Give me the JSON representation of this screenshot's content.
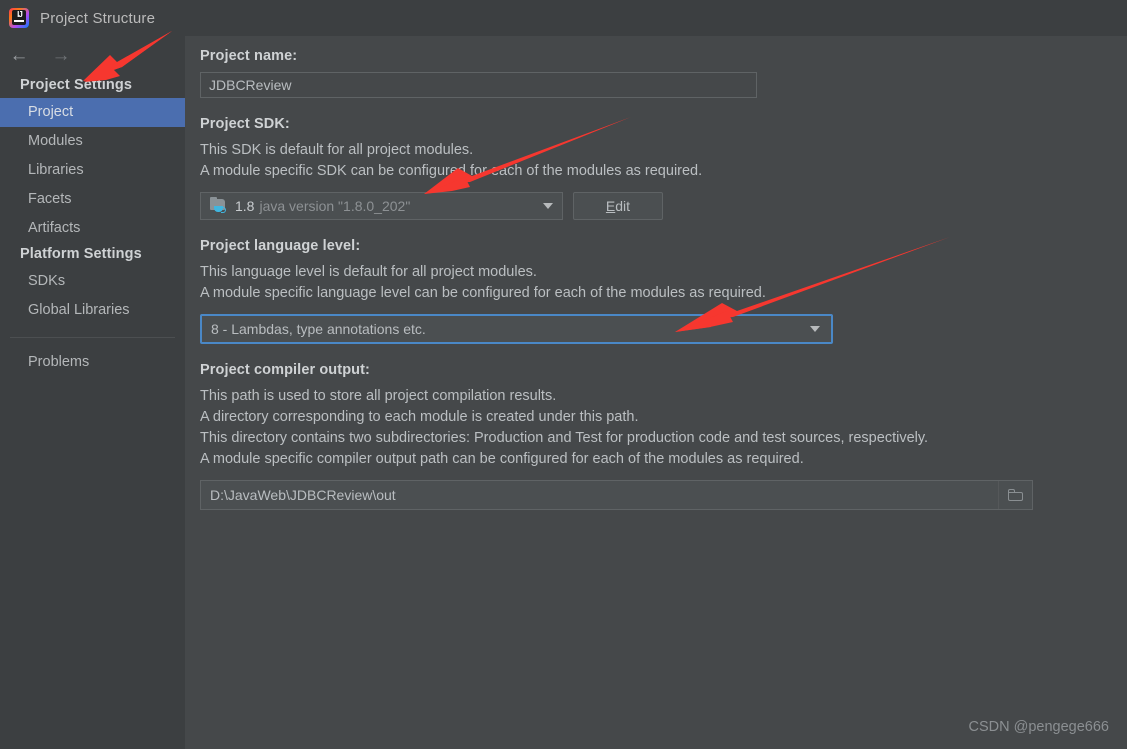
{
  "window": {
    "title": "Project Structure",
    "logo_icon": "intellij-idea-logo"
  },
  "sidebar": {
    "back_icon": "arrow-left-icon",
    "forward_icon": "arrow-right-icon",
    "groups": [
      {
        "header": "Project Settings",
        "items": [
          {
            "label": "Project",
            "selected": true
          },
          {
            "label": "Modules",
            "selected": false
          },
          {
            "label": "Libraries",
            "selected": false
          },
          {
            "label": "Facets",
            "selected": false
          },
          {
            "label": "Artifacts",
            "selected": false
          }
        ]
      },
      {
        "header": "Platform Settings",
        "items": [
          {
            "label": "SDKs",
            "selected": false
          },
          {
            "label": "Global Libraries",
            "selected": false
          }
        ]
      }
    ],
    "problems": {
      "label": "Problems"
    }
  },
  "main": {
    "project_name": {
      "label": "Project name:",
      "value": "JDBCReview"
    },
    "project_sdk": {
      "label": "Project SDK:",
      "desc_line1": "This SDK is default for all project modules.",
      "desc_line2": "A module specific SDK can be configured for each of the modules as required.",
      "sdk_icon": "java-sdk-folder-icon",
      "value_version": "1.8",
      "value_detail": "java version \"1.8.0_202\"",
      "dropdown_icon": "chevron-down-icon",
      "edit_button": {
        "mnemonic": "E",
        "rest": "dit"
      }
    },
    "language_level": {
      "label": "Project language level:",
      "desc_line1": "This language level is default for all project modules.",
      "desc_line2": "A module specific language level can be configured for each of the modules as required.",
      "value": "8 - Lambdas, type annotations etc.",
      "dropdown_icon": "chevron-down-icon"
    },
    "compiler_output": {
      "label": "Project compiler output:",
      "desc_line1": "This path is used to store all project compilation results.",
      "desc_line2": "A directory corresponding to each module is created under this path.",
      "desc_line3": "This directory contains two subdirectories: Production and Test for production code and test sources, respectively.",
      "desc_line4": "A module specific compiler output path can be configured for each of the modules as required.",
      "value": "D:\\JavaWeb\\JDBCReview\\out",
      "browse_icon": "folder-icon"
    }
  },
  "annotations": {
    "color": "#f6372f",
    "arrows": [
      {
        "name": "arrow-to-project-settings"
      },
      {
        "name": "arrow-to-project-sdk"
      },
      {
        "name": "arrow-to-language-level"
      }
    ]
  },
  "watermark": {
    "text": "CSDN @pengege666"
  }
}
